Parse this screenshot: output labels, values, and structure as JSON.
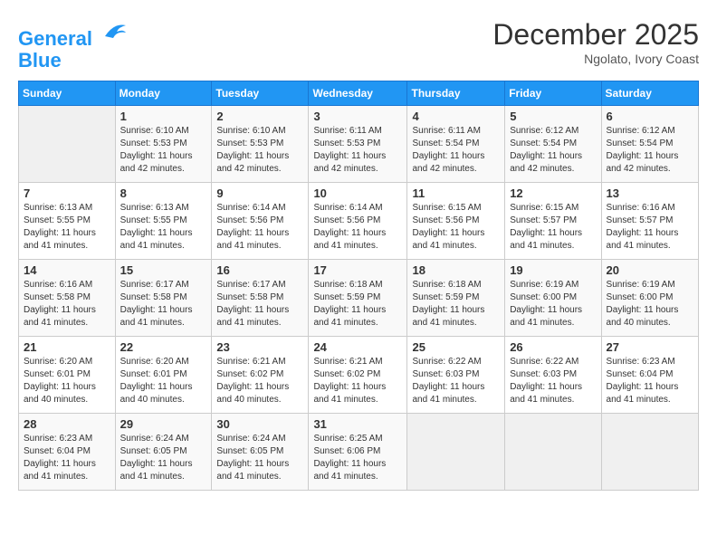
{
  "header": {
    "logo_line1": "General",
    "logo_line2": "Blue",
    "month_title": "December 2025",
    "subtitle": "Ngolato, Ivory Coast"
  },
  "weekdays": [
    "Sunday",
    "Monday",
    "Tuesday",
    "Wednesday",
    "Thursday",
    "Friday",
    "Saturday"
  ],
  "weeks": [
    [
      {
        "day": "",
        "sunrise": "",
        "sunset": "",
        "daylight": ""
      },
      {
        "day": "1",
        "sunrise": "6:10 AM",
        "sunset": "5:53 PM",
        "daylight": "11 hours and 42 minutes."
      },
      {
        "day": "2",
        "sunrise": "6:10 AM",
        "sunset": "5:53 PM",
        "daylight": "11 hours and 42 minutes."
      },
      {
        "day": "3",
        "sunrise": "6:11 AM",
        "sunset": "5:53 PM",
        "daylight": "11 hours and 42 minutes."
      },
      {
        "day": "4",
        "sunrise": "6:11 AM",
        "sunset": "5:54 PM",
        "daylight": "11 hours and 42 minutes."
      },
      {
        "day": "5",
        "sunrise": "6:12 AM",
        "sunset": "5:54 PM",
        "daylight": "11 hours and 42 minutes."
      },
      {
        "day": "6",
        "sunrise": "6:12 AM",
        "sunset": "5:54 PM",
        "daylight": "11 hours and 42 minutes."
      }
    ],
    [
      {
        "day": "7",
        "sunrise": "6:13 AM",
        "sunset": "5:55 PM",
        "daylight": "11 hours and 41 minutes."
      },
      {
        "day": "8",
        "sunrise": "6:13 AM",
        "sunset": "5:55 PM",
        "daylight": "11 hours and 41 minutes."
      },
      {
        "day": "9",
        "sunrise": "6:14 AM",
        "sunset": "5:56 PM",
        "daylight": "11 hours and 41 minutes."
      },
      {
        "day": "10",
        "sunrise": "6:14 AM",
        "sunset": "5:56 PM",
        "daylight": "11 hours and 41 minutes."
      },
      {
        "day": "11",
        "sunrise": "6:15 AM",
        "sunset": "5:56 PM",
        "daylight": "11 hours and 41 minutes."
      },
      {
        "day": "12",
        "sunrise": "6:15 AM",
        "sunset": "5:57 PM",
        "daylight": "11 hours and 41 minutes."
      },
      {
        "day": "13",
        "sunrise": "6:16 AM",
        "sunset": "5:57 PM",
        "daylight": "11 hours and 41 minutes."
      }
    ],
    [
      {
        "day": "14",
        "sunrise": "6:16 AM",
        "sunset": "5:58 PM",
        "daylight": "11 hours and 41 minutes."
      },
      {
        "day": "15",
        "sunrise": "6:17 AM",
        "sunset": "5:58 PM",
        "daylight": "11 hours and 41 minutes."
      },
      {
        "day": "16",
        "sunrise": "6:17 AM",
        "sunset": "5:58 PM",
        "daylight": "11 hours and 41 minutes."
      },
      {
        "day": "17",
        "sunrise": "6:18 AM",
        "sunset": "5:59 PM",
        "daylight": "11 hours and 41 minutes."
      },
      {
        "day": "18",
        "sunrise": "6:18 AM",
        "sunset": "5:59 PM",
        "daylight": "11 hours and 41 minutes."
      },
      {
        "day": "19",
        "sunrise": "6:19 AM",
        "sunset": "6:00 PM",
        "daylight": "11 hours and 41 minutes."
      },
      {
        "day": "20",
        "sunrise": "6:19 AM",
        "sunset": "6:00 PM",
        "daylight": "11 hours and 40 minutes."
      }
    ],
    [
      {
        "day": "21",
        "sunrise": "6:20 AM",
        "sunset": "6:01 PM",
        "daylight": "11 hours and 40 minutes."
      },
      {
        "day": "22",
        "sunrise": "6:20 AM",
        "sunset": "6:01 PM",
        "daylight": "11 hours and 40 minutes."
      },
      {
        "day": "23",
        "sunrise": "6:21 AM",
        "sunset": "6:02 PM",
        "daylight": "11 hours and 40 minutes."
      },
      {
        "day": "24",
        "sunrise": "6:21 AM",
        "sunset": "6:02 PM",
        "daylight": "11 hours and 41 minutes."
      },
      {
        "day": "25",
        "sunrise": "6:22 AM",
        "sunset": "6:03 PM",
        "daylight": "11 hours and 41 minutes."
      },
      {
        "day": "26",
        "sunrise": "6:22 AM",
        "sunset": "6:03 PM",
        "daylight": "11 hours and 41 minutes."
      },
      {
        "day": "27",
        "sunrise": "6:23 AM",
        "sunset": "6:04 PM",
        "daylight": "11 hours and 41 minutes."
      }
    ],
    [
      {
        "day": "28",
        "sunrise": "6:23 AM",
        "sunset": "6:04 PM",
        "daylight": "11 hours and 41 minutes."
      },
      {
        "day": "29",
        "sunrise": "6:24 AM",
        "sunset": "6:05 PM",
        "daylight": "11 hours and 41 minutes."
      },
      {
        "day": "30",
        "sunrise": "6:24 AM",
        "sunset": "6:05 PM",
        "daylight": "11 hours and 41 minutes."
      },
      {
        "day": "31",
        "sunrise": "6:25 AM",
        "sunset": "6:06 PM",
        "daylight": "11 hours and 41 minutes."
      },
      {
        "day": "",
        "sunrise": "",
        "sunset": "",
        "daylight": ""
      },
      {
        "day": "",
        "sunrise": "",
        "sunset": "",
        "daylight": ""
      },
      {
        "day": "",
        "sunrise": "",
        "sunset": "",
        "daylight": ""
      }
    ]
  ]
}
